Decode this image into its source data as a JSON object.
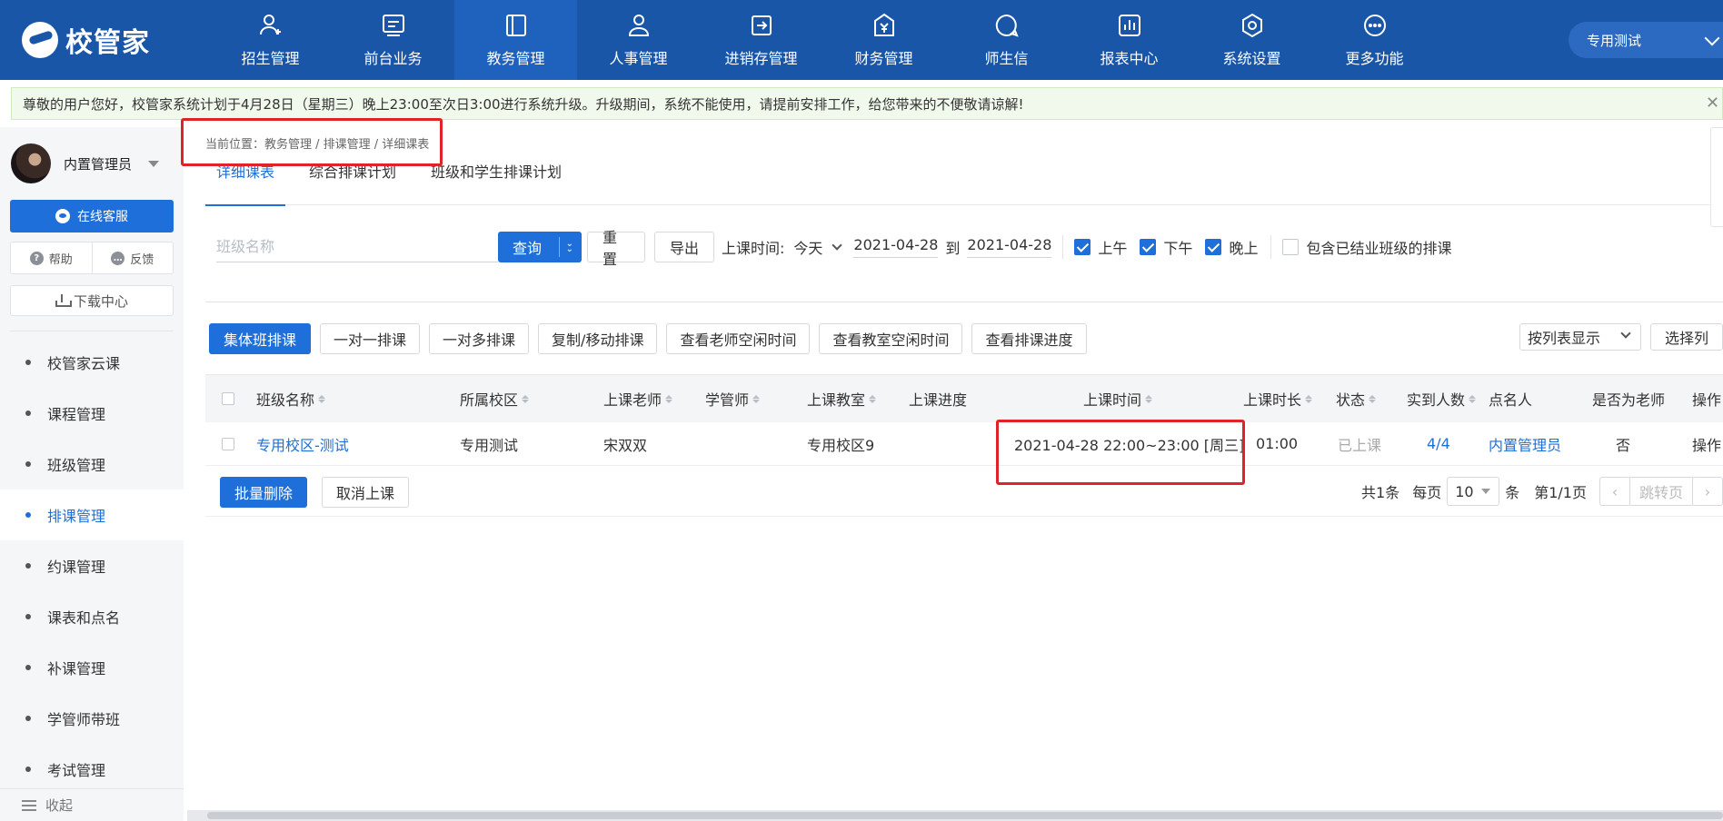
{
  "app": {
    "logo_text": "校管家"
  },
  "nav": [
    {
      "label": "招生管理",
      "icon": "user-plus-icon"
    },
    {
      "label": "前台业务",
      "icon": "monitor-icon"
    },
    {
      "label": "教务管理",
      "icon": "book-icon",
      "active": true
    },
    {
      "label": "人事管理",
      "icon": "person-icon"
    },
    {
      "label": "进销存管理",
      "icon": "box-arrow-icon"
    },
    {
      "label": "财务管理",
      "icon": "finance-icon"
    },
    {
      "label": "师生信",
      "icon": "message-icon"
    },
    {
      "label": "报表中心",
      "icon": "chart-icon"
    },
    {
      "label": "系统设置",
      "icon": "settings-icon"
    },
    {
      "label": "更多功能",
      "icon": "more-icon"
    }
  ],
  "user_select": {
    "value": "专用测试"
  },
  "notice": {
    "text": "尊敬的用户您好，校管家系统计划于4月28日（星期三）晚上23:00至次日3:00进行系统升级。升级期间，系统不能使用，请提前安排工作，给您带来的不便敬请谅解!"
  },
  "sidebar": {
    "user_name": "内置管理员",
    "service_label": "在线客服",
    "help_label": "帮助",
    "feedback_label": "反馈",
    "download_label": "下载中心",
    "items": [
      {
        "label": "校管家云课"
      },
      {
        "label": "课程管理"
      },
      {
        "label": "班级管理"
      },
      {
        "label": "排课管理",
        "active": true
      },
      {
        "label": "约课管理"
      },
      {
        "label": "课表和点名"
      },
      {
        "label": "补课管理"
      },
      {
        "label": "学管师带班"
      },
      {
        "label": "考试管理"
      }
    ],
    "collapse_label": "收起"
  },
  "breadcrumb": "当前位置：教务管理 / 排课管理 / 详细课表",
  "tabs": [
    {
      "label": "详细课表",
      "active": true
    },
    {
      "label": "综合排课计划"
    },
    {
      "label": "班级和学生排课计划"
    }
  ],
  "filters": {
    "class_placeholder": "班级名称",
    "query_label": "查询",
    "reset_label": "重置",
    "export_label": "导出",
    "time_label": "上课时间:",
    "time_range": "今天",
    "date_from": "2021-04-28",
    "to_label": "到",
    "date_to": "2021-04-28",
    "morning_label": "上午",
    "afternoon_label": "下午",
    "evening_label": "晚上",
    "include_finished_label": "包含已结业班级的排课"
  },
  "actions": {
    "buttons": [
      "集体班排课",
      "一对一排课",
      "一对多排课",
      "复制/移动排课",
      "查看老师空闲时间",
      "查看教室空闲时间",
      "查看排课进度"
    ],
    "view_mode": "按列表显示",
    "choose_columns": "选择列"
  },
  "table": {
    "columns": [
      "班级名称",
      "所属校区",
      "上课老师",
      "学管师",
      "上课教室",
      "上课进度",
      "上课时间",
      "上课时长",
      "状态",
      "实到人数",
      "点名人",
      "是否为老师",
      "操作"
    ],
    "rows": [
      {
        "class_name": "专用校区-测试",
        "campus": "专用测试",
        "teacher": "宋双双",
        "manager": "",
        "classroom": "专用校区9",
        "progress": "",
        "time": "2021-04-28 22:00~23:00 [周三]",
        "duration": "01:00",
        "status": "已上课",
        "attendance": "4/4",
        "roll_caller": "内置管理员",
        "is_teacher": "否",
        "op": "操作"
      }
    ],
    "batch_delete": "批量删除",
    "cancel_class": "取消上课"
  },
  "pager": {
    "total": "共1条",
    "per_page_label": "每页",
    "per_page": "10",
    "unit": "条",
    "page_info": "第1/1页",
    "jump_label": "跳转页"
  }
}
